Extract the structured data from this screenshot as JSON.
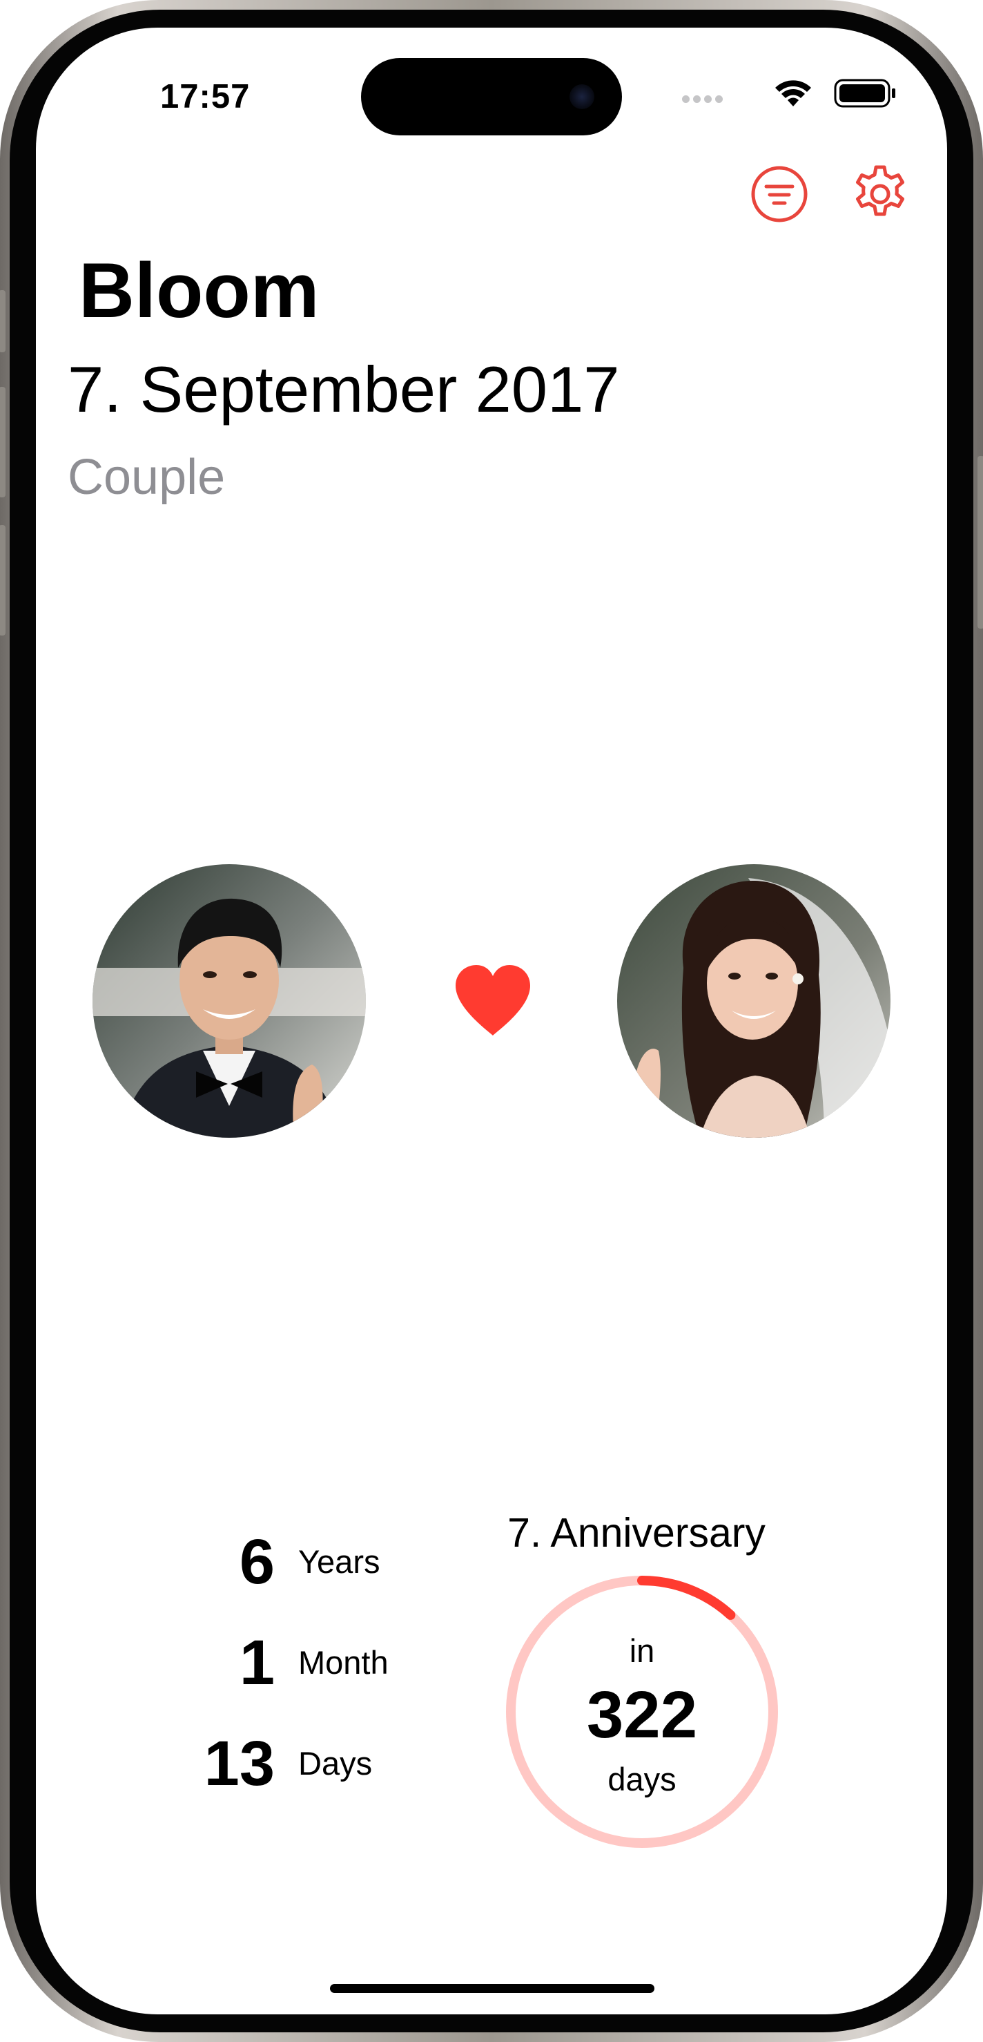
{
  "status_bar": {
    "time": "17:57"
  },
  "toolbar": {
    "filter_icon": "list-circle-icon",
    "settings_icon": "gear-icon",
    "accent": "#E8453C"
  },
  "header": {
    "title": "Bloom",
    "date": "7. September 2017",
    "subtitle": "Couple"
  },
  "couple": {
    "left_avatar": "groom-photo",
    "right_avatar": "bride-photo",
    "heart_icon": "heart-icon",
    "heart_color": "#FF3B30"
  },
  "duration": {
    "years_value": "6",
    "years_label": "Years",
    "months_value": "1",
    "months_label": "Month",
    "days_value": "13",
    "days_label": "Days"
  },
  "anniversary": {
    "title": "7. Anniversary",
    "prefix": "in",
    "days_value": "322",
    "suffix": "days",
    "progress": 0.118,
    "ring_track_color": "#FFC7C4",
    "ring_progress_color": "#FF3B30"
  }
}
